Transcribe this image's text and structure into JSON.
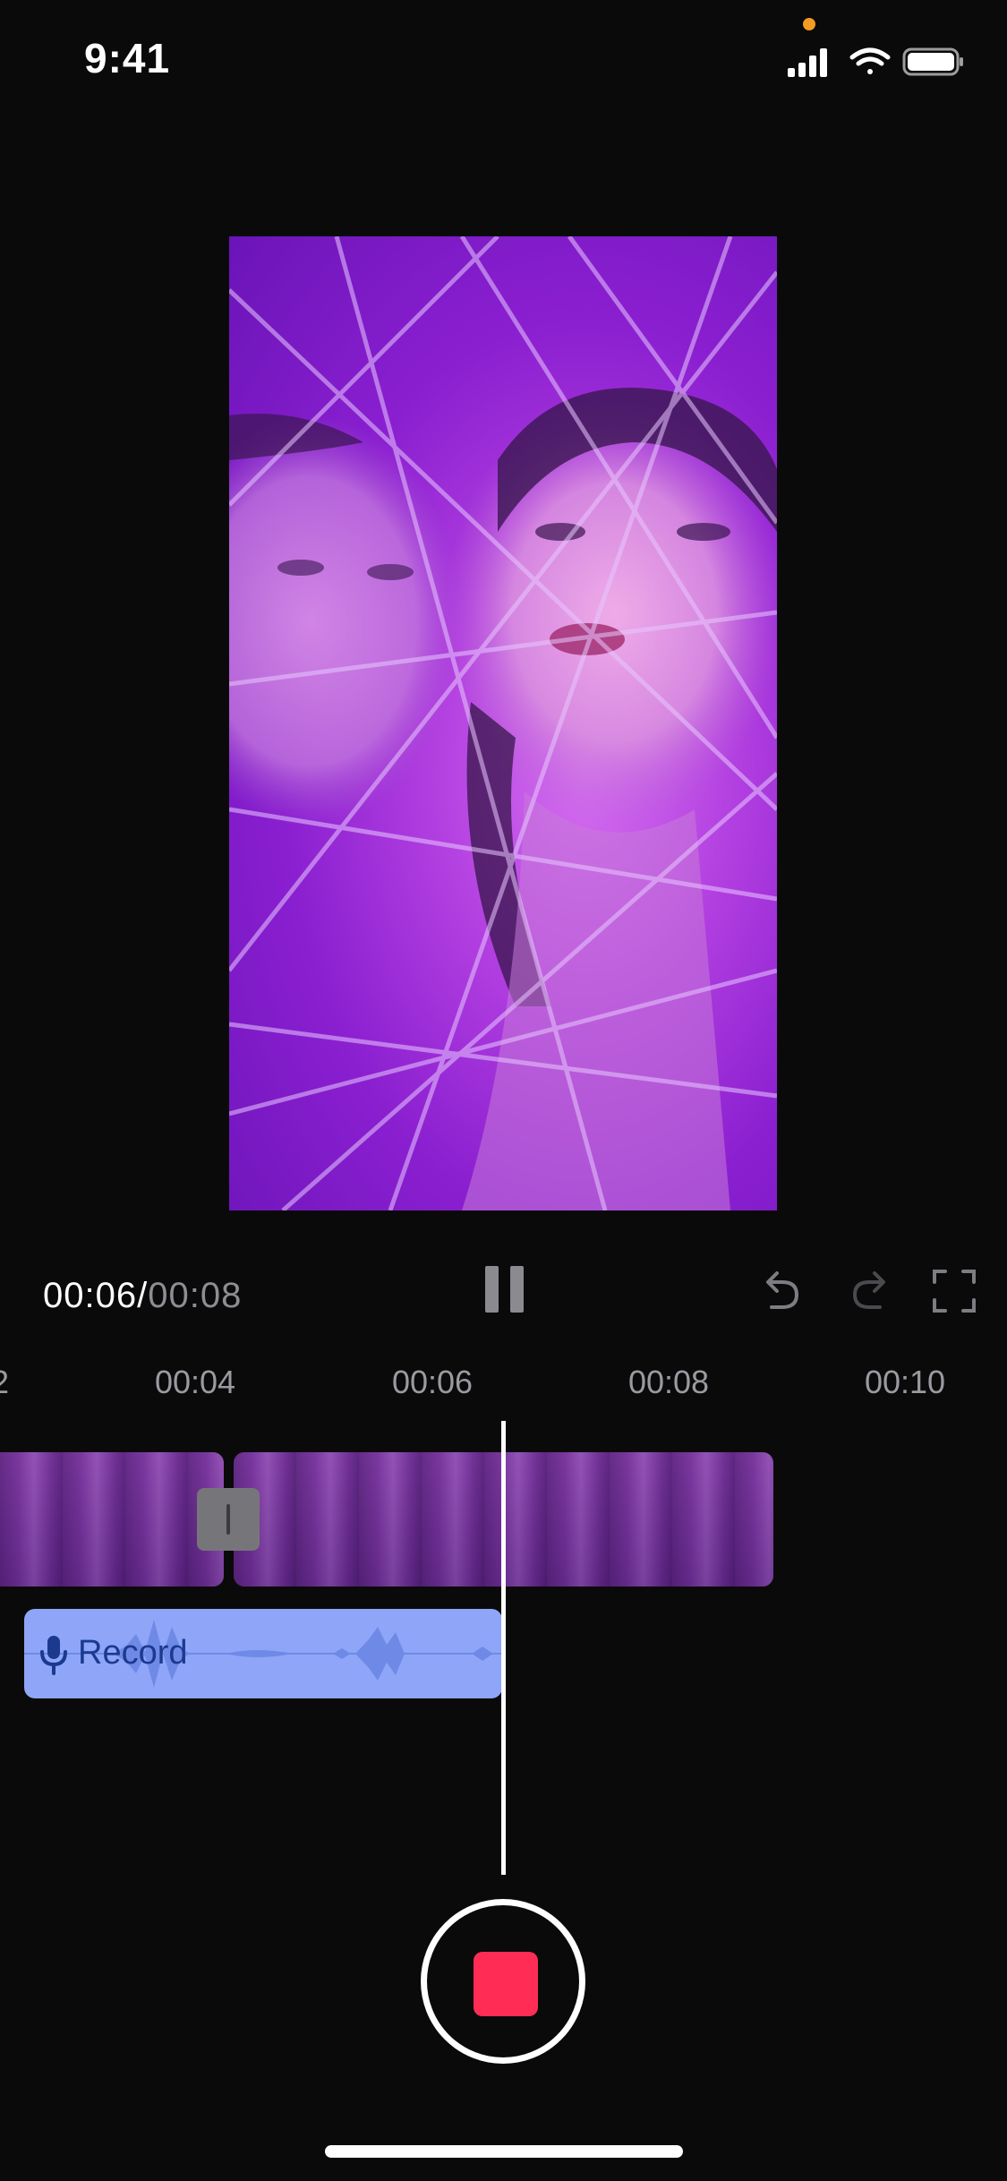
{
  "status_bar": {
    "time": "9:41",
    "privacy_dot_color": "#f59a23",
    "icons": [
      "cellular-signal-icon",
      "wifi-icon",
      "battery-icon"
    ]
  },
  "preview": {
    "content": "video-frame"
  },
  "playback": {
    "current_time": "00:06",
    "separator": "/",
    "total_time": "00:08",
    "pause_icon": "pause-icon",
    "undo_icon": "undo-icon",
    "redo_icon": "redo-icon",
    "fullscreen_icon": "fullscreen-icon"
  },
  "timeline": {
    "ruler_labels": [
      "2",
      "00:04",
      "00:06",
      "00:08",
      "00:10"
    ],
    "record_track": {
      "label": "Record",
      "color": "#8fa6f8",
      "label_color": "#1b3a8f"
    }
  },
  "record_button": {
    "state": "recording",
    "stop_color": "#ff2d55"
  }
}
